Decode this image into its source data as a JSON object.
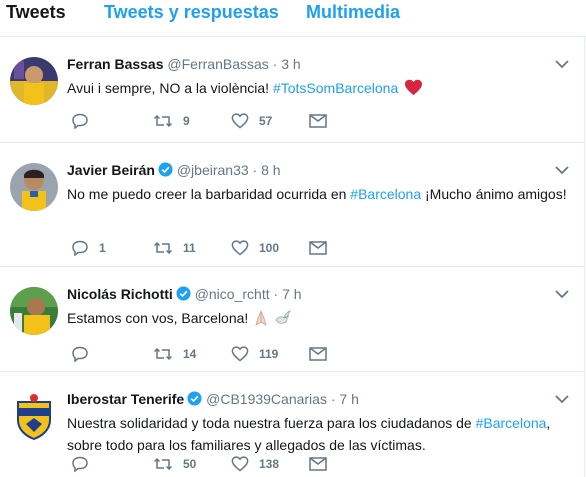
{
  "tabs": [
    "Tweets",
    "Tweets y respuestas",
    "Multimedia"
  ],
  "colors": {
    "accent": "#1da1f2",
    "muted": "#657786",
    "heart": "#e0245e"
  },
  "tweets": [
    {
      "name": "Ferran Bassas",
      "handle": "@FerranBassas",
      "dot": "·",
      "time": "3 h",
      "verified": false,
      "text_before": "Avui i sempre, NO a la violència! ",
      "hashtag": "#TotsSomBarcelona",
      "text_after": "",
      "emoji": "heart",
      "replies": "",
      "retweets": "9",
      "likes": "57"
    },
    {
      "name": "Javier Beirán",
      "handle": "@jbeiran33",
      "dot": "·",
      "time": "8 h",
      "verified": true,
      "text_before": "No me puedo creer la barbaridad ocurrida en ",
      "hashtag": "#Barcelona",
      "text_after": " ¡Mucho ánimo amigos!",
      "replies": "1",
      "retweets": "11",
      "likes": "100"
    },
    {
      "name": "Nicolás Richotti",
      "handle": "@nico_rchtt",
      "dot": "·",
      "time": "7 h",
      "verified": true,
      "text_before": "Estamos con vos, Barcelona! ",
      "hashtag": "",
      "text_after": "",
      "emoji": "folded-hands-dove",
      "replies": "",
      "retweets": "14",
      "likes": "119"
    },
    {
      "name": "Iberostar Tenerife",
      "handle": "@CB1939Canarias",
      "dot": "·",
      "time": "7 h",
      "verified": true,
      "text_before": "Nuestra solidaridad y toda nuestra fuerza para los ciudadanos de ",
      "hashtag": "#Barcelona",
      "text_after": ", sobre todo para los familiares y allegados de las víctimas.",
      "replies": "",
      "retweets": "50",
      "likes": "138"
    }
  ]
}
